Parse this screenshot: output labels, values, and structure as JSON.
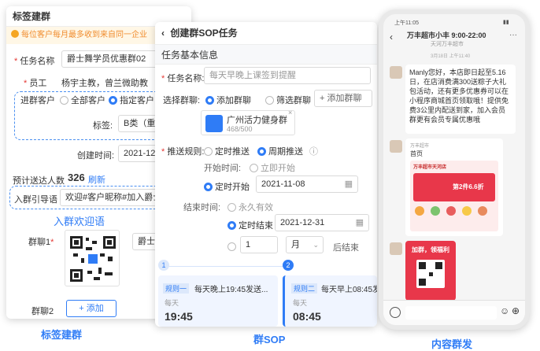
{
  "card1": {
    "title": "标签建群",
    "warning": "每位客户每月最多收到来自同一企业",
    "task_name_label": "任务名称",
    "task_name_value": "爵士舞学员优惠群02",
    "staff_label": "员工",
    "staff_value": "杨宇主教，曾兰微助教",
    "customer_label": "进群客户",
    "customer_options": [
      "全部客户",
      "指定客户"
    ],
    "tag_label": "标签:",
    "tag_value": "B类（重复",
    "created_label": "创建时间:",
    "created_value": "2021-12-",
    "estimate_label": "预计送达人数",
    "estimate_value": "326",
    "refresh": "刷新",
    "guide_label": "入群引导语",
    "guide_value": "欢迎#客户昵称#加入爵士",
    "annotation": "入群欢迎语",
    "group1_label": "群聊1",
    "group1_value": "爵士",
    "group2_label": "群聊2",
    "add_button": "+ 添加"
  },
  "card2": {
    "title": "创建群SOP任务",
    "section": "任务基本信息",
    "task_name_label": "任务名称:",
    "task_name_placeholder": "每天早晚上课签到提醒",
    "select_group_label": "选择群聊:",
    "add_group_radio": "添加群聊",
    "filter_group_radio": "筛选群聊",
    "add_group_button": "+ 添加群聊",
    "group_name": "广州活力健身群",
    "group_count": "468/500",
    "push_rule_label": "推送规则:",
    "scheduled_push": "定时推送",
    "periodic_push": "周期推送",
    "start_time_label": "开始时间:",
    "start_now": "立即开始",
    "start_scheduled": "定时开始",
    "start_date": "2021-11-08",
    "end_time_label": "结束时间:",
    "forever": "永久有效",
    "end_scheduled": "定时结束",
    "end_date": "2021-12-31",
    "month_count": "1",
    "month_unit": "月",
    "month_suffix": "后结束",
    "step1": "1",
    "step2": "2",
    "rule1_tag": "规则一",
    "rule1_text": "每天晚上19:45发送...",
    "rule1_freq": "每天",
    "rule1_time": "19:45",
    "rule2_tag": "规则二",
    "rule2_text": "每天早上08:45发",
    "rule2_freq": "每天",
    "rule2_time": "08:45"
  },
  "card3": {
    "status_left": "上午11:05",
    "chat_title": "万丰超市小丰 9:00-22:00",
    "chat_subtitle": "天河万丰超市",
    "timestamp": "3月18日 上午11:40",
    "msg1": "Manly您好，本店即日起至5.16日，在店消费满300送粽子大礼包活动，还有更多优惠券可以在小程序商城首页领取哦！提供免费3公里内配送到家，加入会员群更有会员专属优惠哦",
    "mini_sender": "万丰超市",
    "mini_title": "首页",
    "mini_store": "万丰超市天河店",
    "mini_promo": "第2件6.6折",
    "qr_header": "加群，领福利"
  },
  "bottom_labels": {
    "left": "标签建群",
    "middle": "群SOP",
    "right": "内容群发"
  },
  "colors": {
    "accent": "#2f7cf6",
    "warning": "#f08c2e",
    "promo": "#e8374a"
  }
}
